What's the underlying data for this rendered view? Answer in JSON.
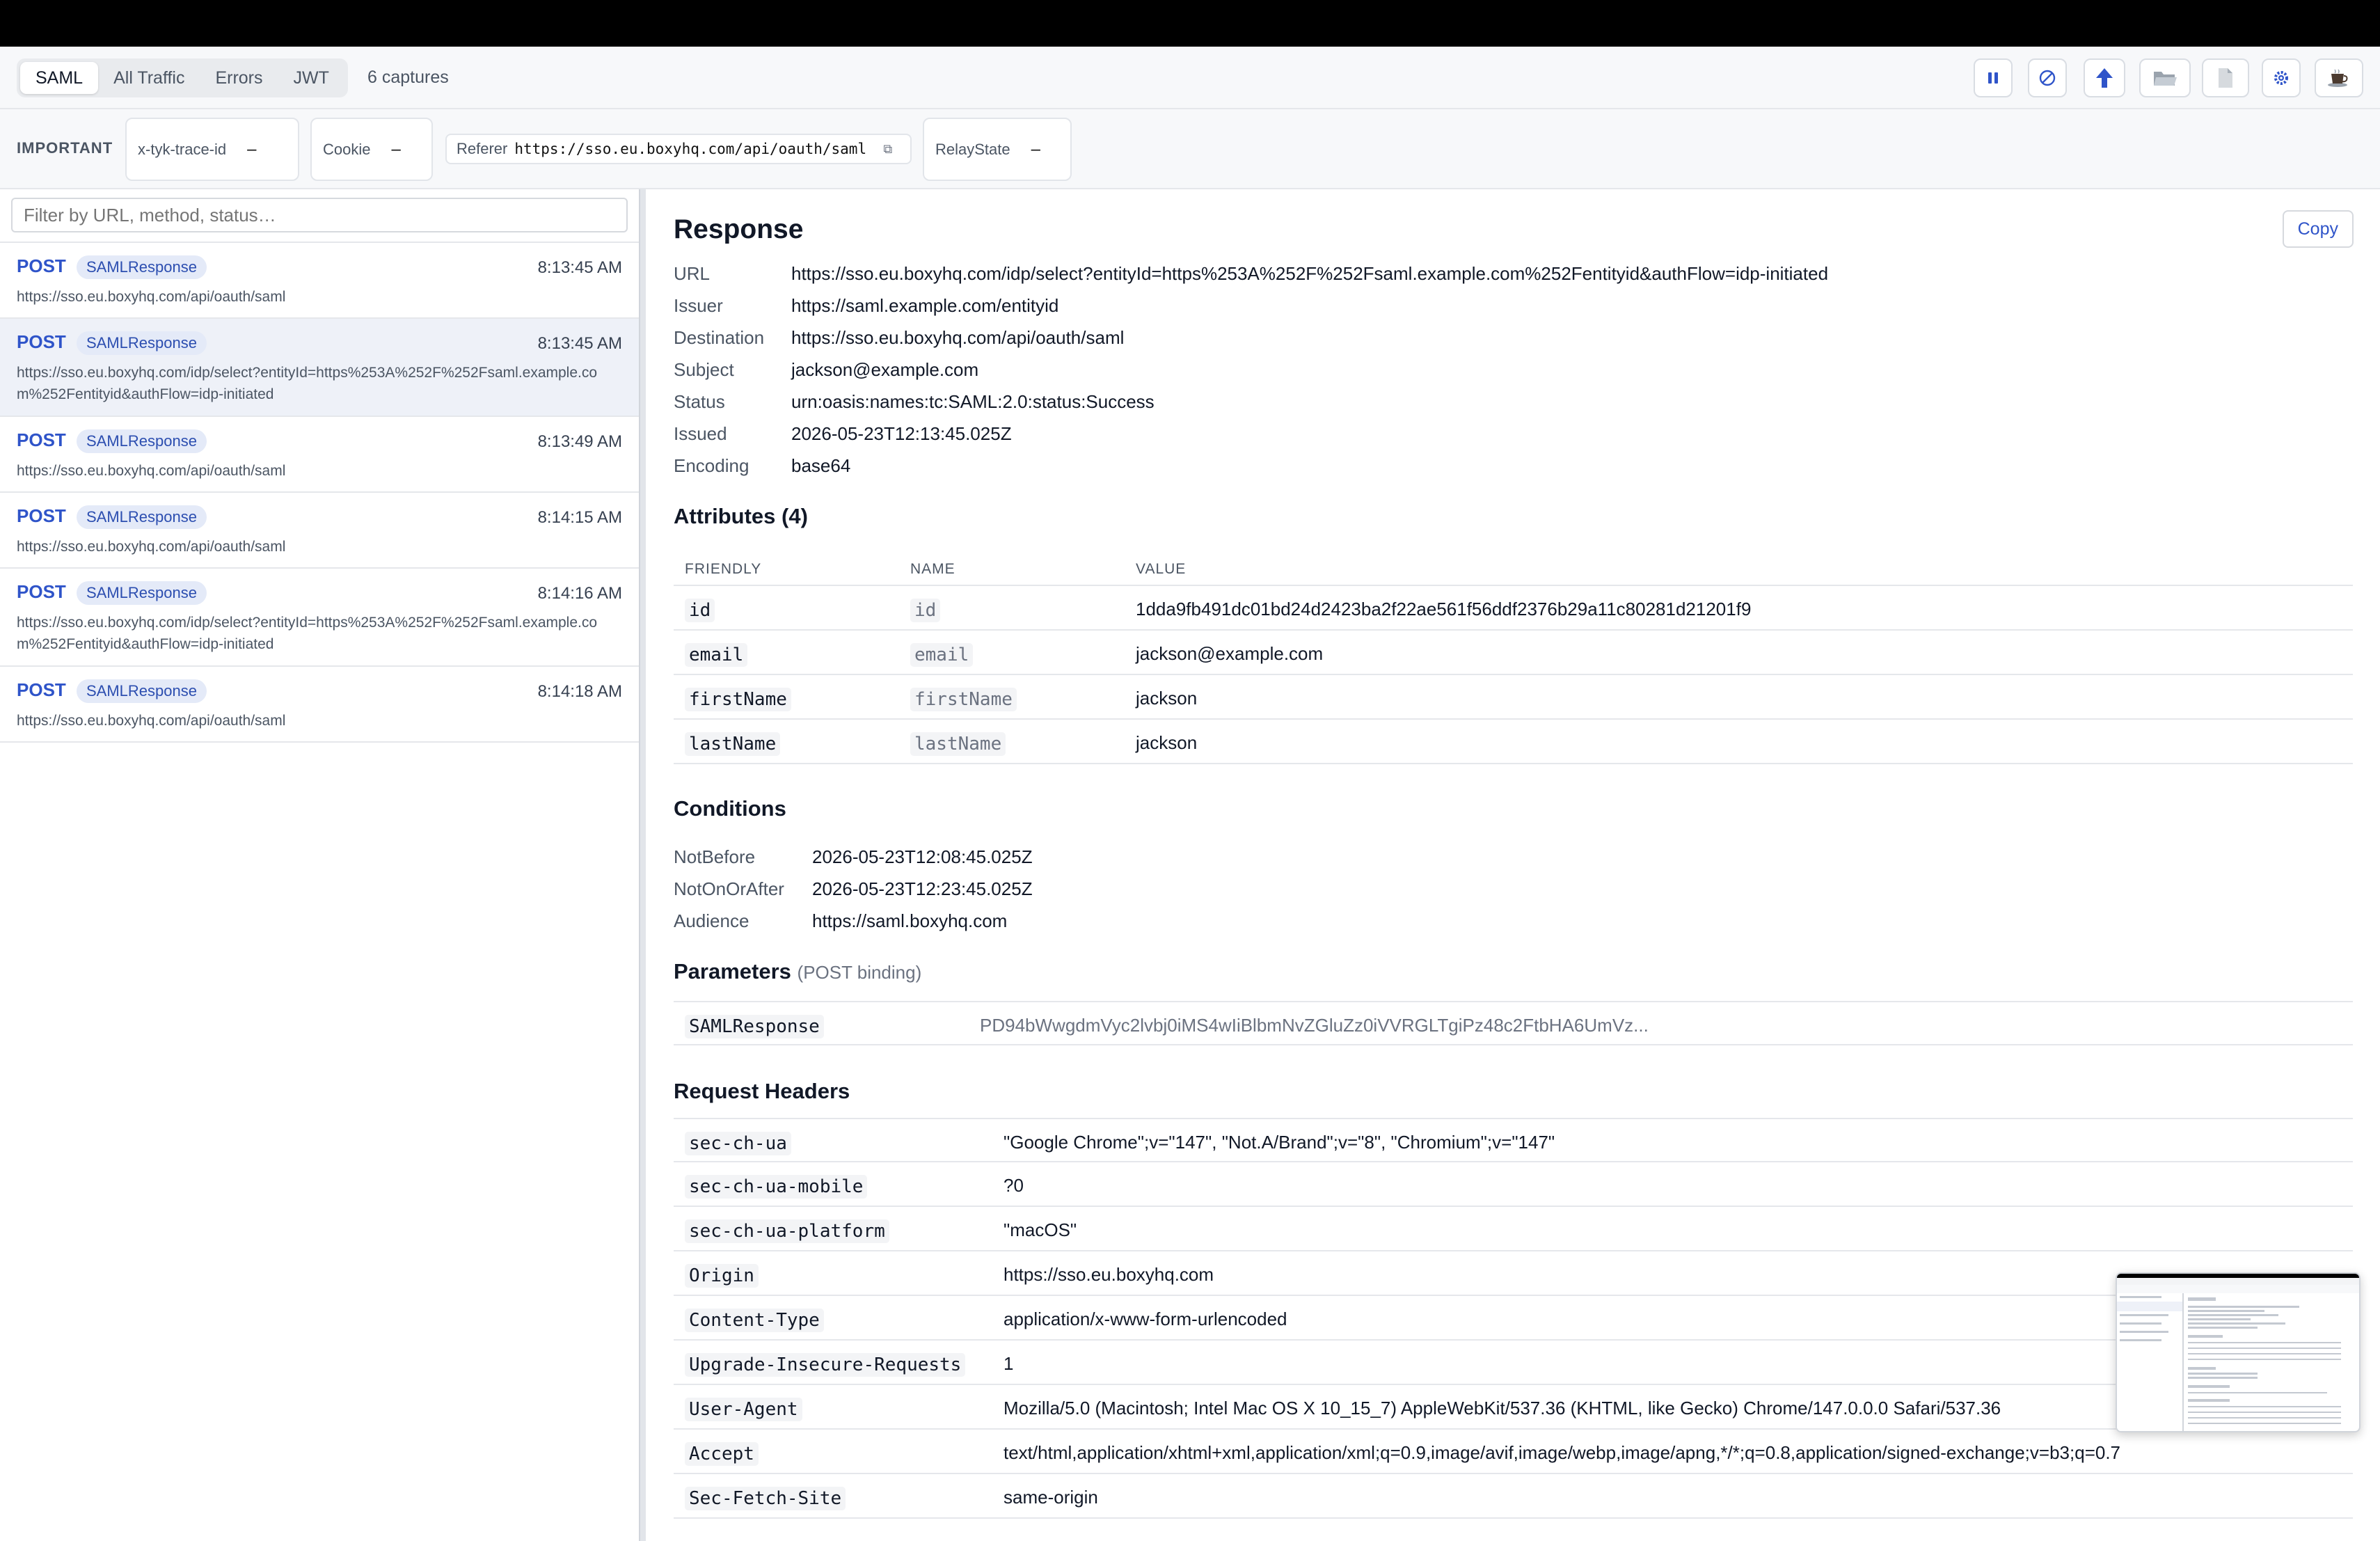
{
  "toolbar": {
    "tabs": [
      {
        "label": "SAML",
        "active": true
      },
      {
        "label": "All Traffic",
        "active": false
      },
      {
        "label": "Errors",
        "active": false
      },
      {
        "label": "JWT",
        "active": false
      }
    ],
    "captures": "6 captures",
    "icons": [
      "pause-icon",
      "clear-icon",
      "export-icon",
      "open-folder-icon",
      "file-icon",
      "settings-icon",
      "coffee-icon"
    ]
  },
  "important": {
    "label": "IMPORTANT",
    "chips": [
      {
        "name": "x-tyk-trace-id",
        "value": "–"
      },
      {
        "name": "Cookie",
        "value": "–"
      },
      {
        "name": "Referer",
        "value": "https://sso.eu.boxyhq.com/api/oauth/saml"
      },
      {
        "name": "RelayState",
        "value": "–"
      }
    ]
  },
  "filter": {
    "placeholder": "Filter by URL, method, status…"
  },
  "requests": [
    {
      "method": "POST",
      "badge": "SAMLResponse",
      "time": "8:13:45 AM",
      "url": "https://sso.eu.boxyhq.com/api/oauth/saml",
      "selected": false
    },
    {
      "method": "POST",
      "badge": "SAMLResponse",
      "time": "8:13:45 AM",
      "url": "https://sso.eu.boxyhq.com/idp/select?entityId=https%253A%252F%252Fsaml.example.com%252Fentityid&authFlow=idp-initiated",
      "selected": true
    },
    {
      "method": "POST",
      "badge": "SAMLResponse",
      "time": "8:13:49 AM",
      "url": "https://sso.eu.boxyhq.com/api/oauth/saml",
      "selected": false
    },
    {
      "method": "POST",
      "badge": "SAMLResponse",
      "time": "8:14:15 AM",
      "url": "https://sso.eu.boxyhq.com/api/oauth/saml",
      "selected": false
    },
    {
      "method": "POST",
      "badge": "SAMLResponse",
      "time": "8:14:16 AM",
      "url": "https://sso.eu.boxyhq.com/idp/select?entityId=https%253A%252F%252Fsaml.example.com%252Fentityid&authFlow=idp-initiated",
      "selected": false
    },
    {
      "method": "POST",
      "badge": "SAMLResponse",
      "time": "8:14:18 AM",
      "url": "https://sso.eu.boxyhq.com/api/oauth/saml",
      "selected": false
    }
  ],
  "detail": {
    "copy_label": "Copy",
    "title": "Response",
    "fields": [
      {
        "k": "URL",
        "v": "https://sso.eu.boxyhq.com/idp/select?entityId=https%253A%252F%252Fsaml.example.com%252Fentityid&authFlow=idp-initiated"
      },
      {
        "k": "Issuer",
        "v": "https://saml.example.com/entityid"
      },
      {
        "k": "Destination",
        "v": "https://sso.eu.boxyhq.com/api/oauth/saml"
      },
      {
        "k": "Subject",
        "v": "jackson@example.com"
      },
      {
        "k": "Status",
        "v": "urn:oasis:names:tc:SAML:2.0:status:Success"
      },
      {
        "k": "Issued",
        "v": "2026-05-23T12:13:45.025Z"
      },
      {
        "k": "Encoding",
        "v": "base64"
      }
    ],
    "attributes_title": "Attributes (4)",
    "attr_headers": [
      "FRIENDLY",
      "NAME",
      "VALUE"
    ],
    "attributes": [
      {
        "friendly": "id",
        "name": "id",
        "value": "1dda9fb491dc01bd24d2423ba2f22ae561f56ddf2376b29a11c80281d21201f9"
      },
      {
        "friendly": "email",
        "name": "email",
        "value": "jackson@example.com"
      },
      {
        "friendly": "firstName",
        "name": "firstName",
        "value": "jackson"
      },
      {
        "friendly": "lastName",
        "name": "lastName",
        "value": "jackson"
      }
    ],
    "conditions_title": "Conditions",
    "conditions": [
      {
        "k": "NotBefore",
        "v": "2026-05-23T12:08:45.025Z"
      },
      {
        "k": "NotOnOrAfter",
        "v": "2026-05-23T12:23:45.025Z"
      },
      {
        "k": "Audience",
        "v": "https://saml.boxyhq.com"
      }
    ],
    "params_title": "Parameters",
    "params_sub": "(POST binding)",
    "params": [
      {
        "k": "SAMLResponse",
        "v": "PD94bWwgdmVyc2lvbj0iMS4wIiBlbmNvZGluZz0iVVRGLTgiPz48c2FtbHA6UmVz..."
      }
    ],
    "headers_title": "Request Headers",
    "headers": [
      {
        "k": "sec-ch-ua",
        "v": "\"Google Chrome\";v=\"147\", \"Not.A/Brand\";v=\"8\", \"Chromium\";v=\"147\""
      },
      {
        "k": "sec-ch-ua-mobile",
        "v": "?0"
      },
      {
        "k": "sec-ch-ua-platform",
        "v": "\"macOS\""
      },
      {
        "k": "Origin",
        "v": "https://sso.eu.boxyhq.com"
      },
      {
        "k": "Content-Type",
        "v": "application/x-www-form-urlencoded"
      },
      {
        "k": "Upgrade-Insecure-Requests",
        "v": "1"
      },
      {
        "k": "User-Agent",
        "v": "Mozilla/5.0 (Macintosh; Intel Mac OS X 10_15_7) AppleWebKit/537.36 (KHTML, like Gecko) Chrome/147.0.0.0 Safari/537.36"
      },
      {
        "k": "Accept",
        "v": "text/html,application/xhtml+xml,application/xml;q=0.9,image/avif,image/webp,image/apng,*/*;q=0.8,application/signed-exchange;v=b3;q=0.7"
      },
      {
        "k": "Sec-Fetch-Site",
        "v": "same-origin"
      }
    ]
  },
  "colors": {
    "accent": "#2f54c9",
    "badge_bg": "#e4eaf8",
    "selected_row": "#eef1f8"
  }
}
